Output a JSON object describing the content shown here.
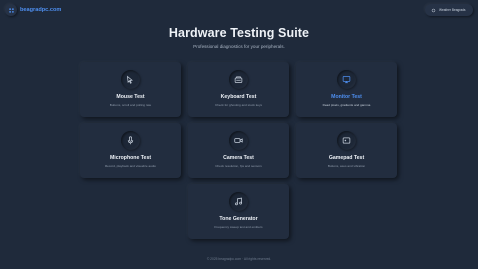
{
  "header": {
    "logo_text": "beagradpc.com",
    "weather_button": "Weather Beagrads"
  },
  "hero": {
    "title": "Hardware Testing Suite",
    "subtitle": "Professional diagnostics for your peripherals."
  },
  "cards": [
    {
      "title": "Mouse Test",
      "desc": "Buttons, scroll and polling rate",
      "icon": "mouse-icon"
    },
    {
      "title": "Keyboard Test",
      "desc": "Check for ghosting and stuck keys",
      "icon": "keyboard-icon"
    },
    {
      "title": "Monitor Test",
      "desc": "Dead pixels, gradients and gamma",
      "icon": "monitor-icon"
    },
    {
      "title": "Microphone Test",
      "desc": "Record, playback and visualize audio",
      "icon": "microphone-icon"
    },
    {
      "title": "Camera Test",
      "desc": "Check resolution, fps and sensors",
      "icon": "camera-icon"
    },
    {
      "title": "Gamepad Test",
      "desc": "Buttons, axes and vibration",
      "icon": "gamepad-icon"
    },
    {
      "title": "Tone Generator",
      "desc": "Frequency sweep test and emitters",
      "icon": "music-note-icon"
    }
  ],
  "footer": {
    "text": "© 2025 beagradpc.com · All rights reserved."
  },
  "colors": {
    "background": "#1f2a3b",
    "card": "#222d3f",
    "accent": "#4e8ff0"
  }
}
